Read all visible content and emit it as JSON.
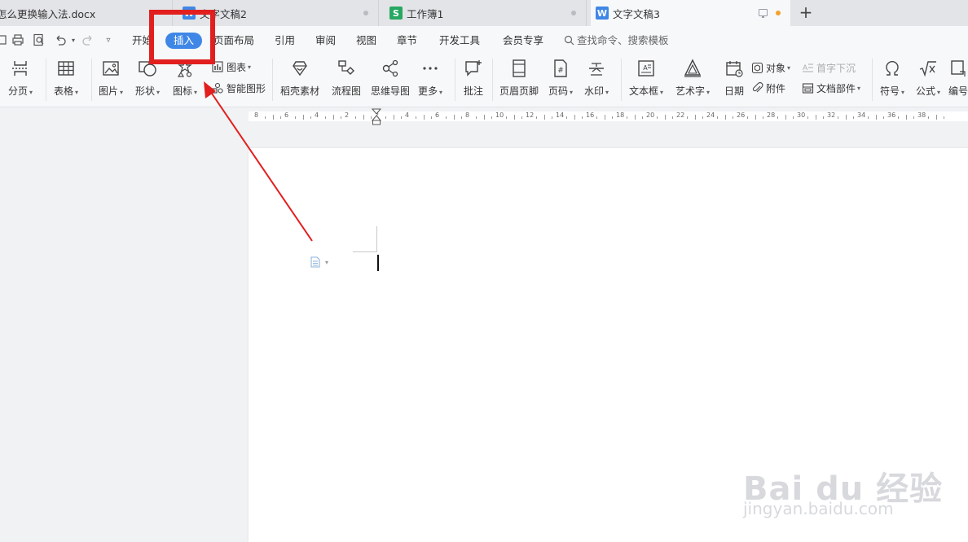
{
  "tabs": [
    {
      "title": "怎么更换输入法.docx",
      "state": "inactive"
    },
    {
      "title": "文字文稿2",
      "state": "inactive",
      "icon_letter": "W",
      "icon_color": "#3f87e6"
    },
    {
      "title": "工作簿1",
      "state": "inactive",
      "icon_letter": "S",
      "icon_color": "#27a761"
    },
    {
      "title": "文字文稿3",
      "state": "active",
      "icon_letter": "W",
      "icon_color": "#3f87e6"
    }
  ],
  "new_tab_label": "+",
  "menus": [
    "开始",
    "插入",
    "页面布局",
    "引用",
    "审阅",
    "视图",
    "章节",
    "开发工具",
    "会员专享"
  ],
  "active_menu": "插入",
  "search_command": "查找命令、搜索模板",
  "ribbon": {
    "page_break": "分页",
    "table": "表格",
    "picture": "图片",
    "shape": "形状",
    "icon": "图标",
    "chart": "图表",
    "smart_graphic": "智能图形",
    "docer_material": "稻壳素材",
    "flowchart": "流程图",
    "mindmap": "思维导图",
    "more": "更多",
    "comment": "批注",
    "header_footer": "页眉页脚",
    "page_number": "页码",
    "watermark": "水印",
    "textbox": "文本框",
    "wordart": "艺术字",
    "date": "日期",
    "object": "对象",
    "attachment": "附件",
    "drop_cap": "首字下沉",
    "doc_parts": "文档部件",
    "symbol": "符号",
    "formula": "公式",
    "numbering": "编号"
  },
  "ruler_labels": [
    "8",
    "6",
    "4",
    "2",
    "2",
    "4",
    "6",
    "8",
    "10",
    "12",
    "14",
    "16",
    "18",
    "20",
    "22",
    "24",
    "26",
    "28",
    "30",
    "32",
    "34",
    "36",
    "38"
  ],
  "watermark_brand": "Bai du 经验",
  "watermark_url": "jingyan.baidu.com",
  "accent_color": "#3f87e6",
  "annotation_color": "#e21f1f"
}
